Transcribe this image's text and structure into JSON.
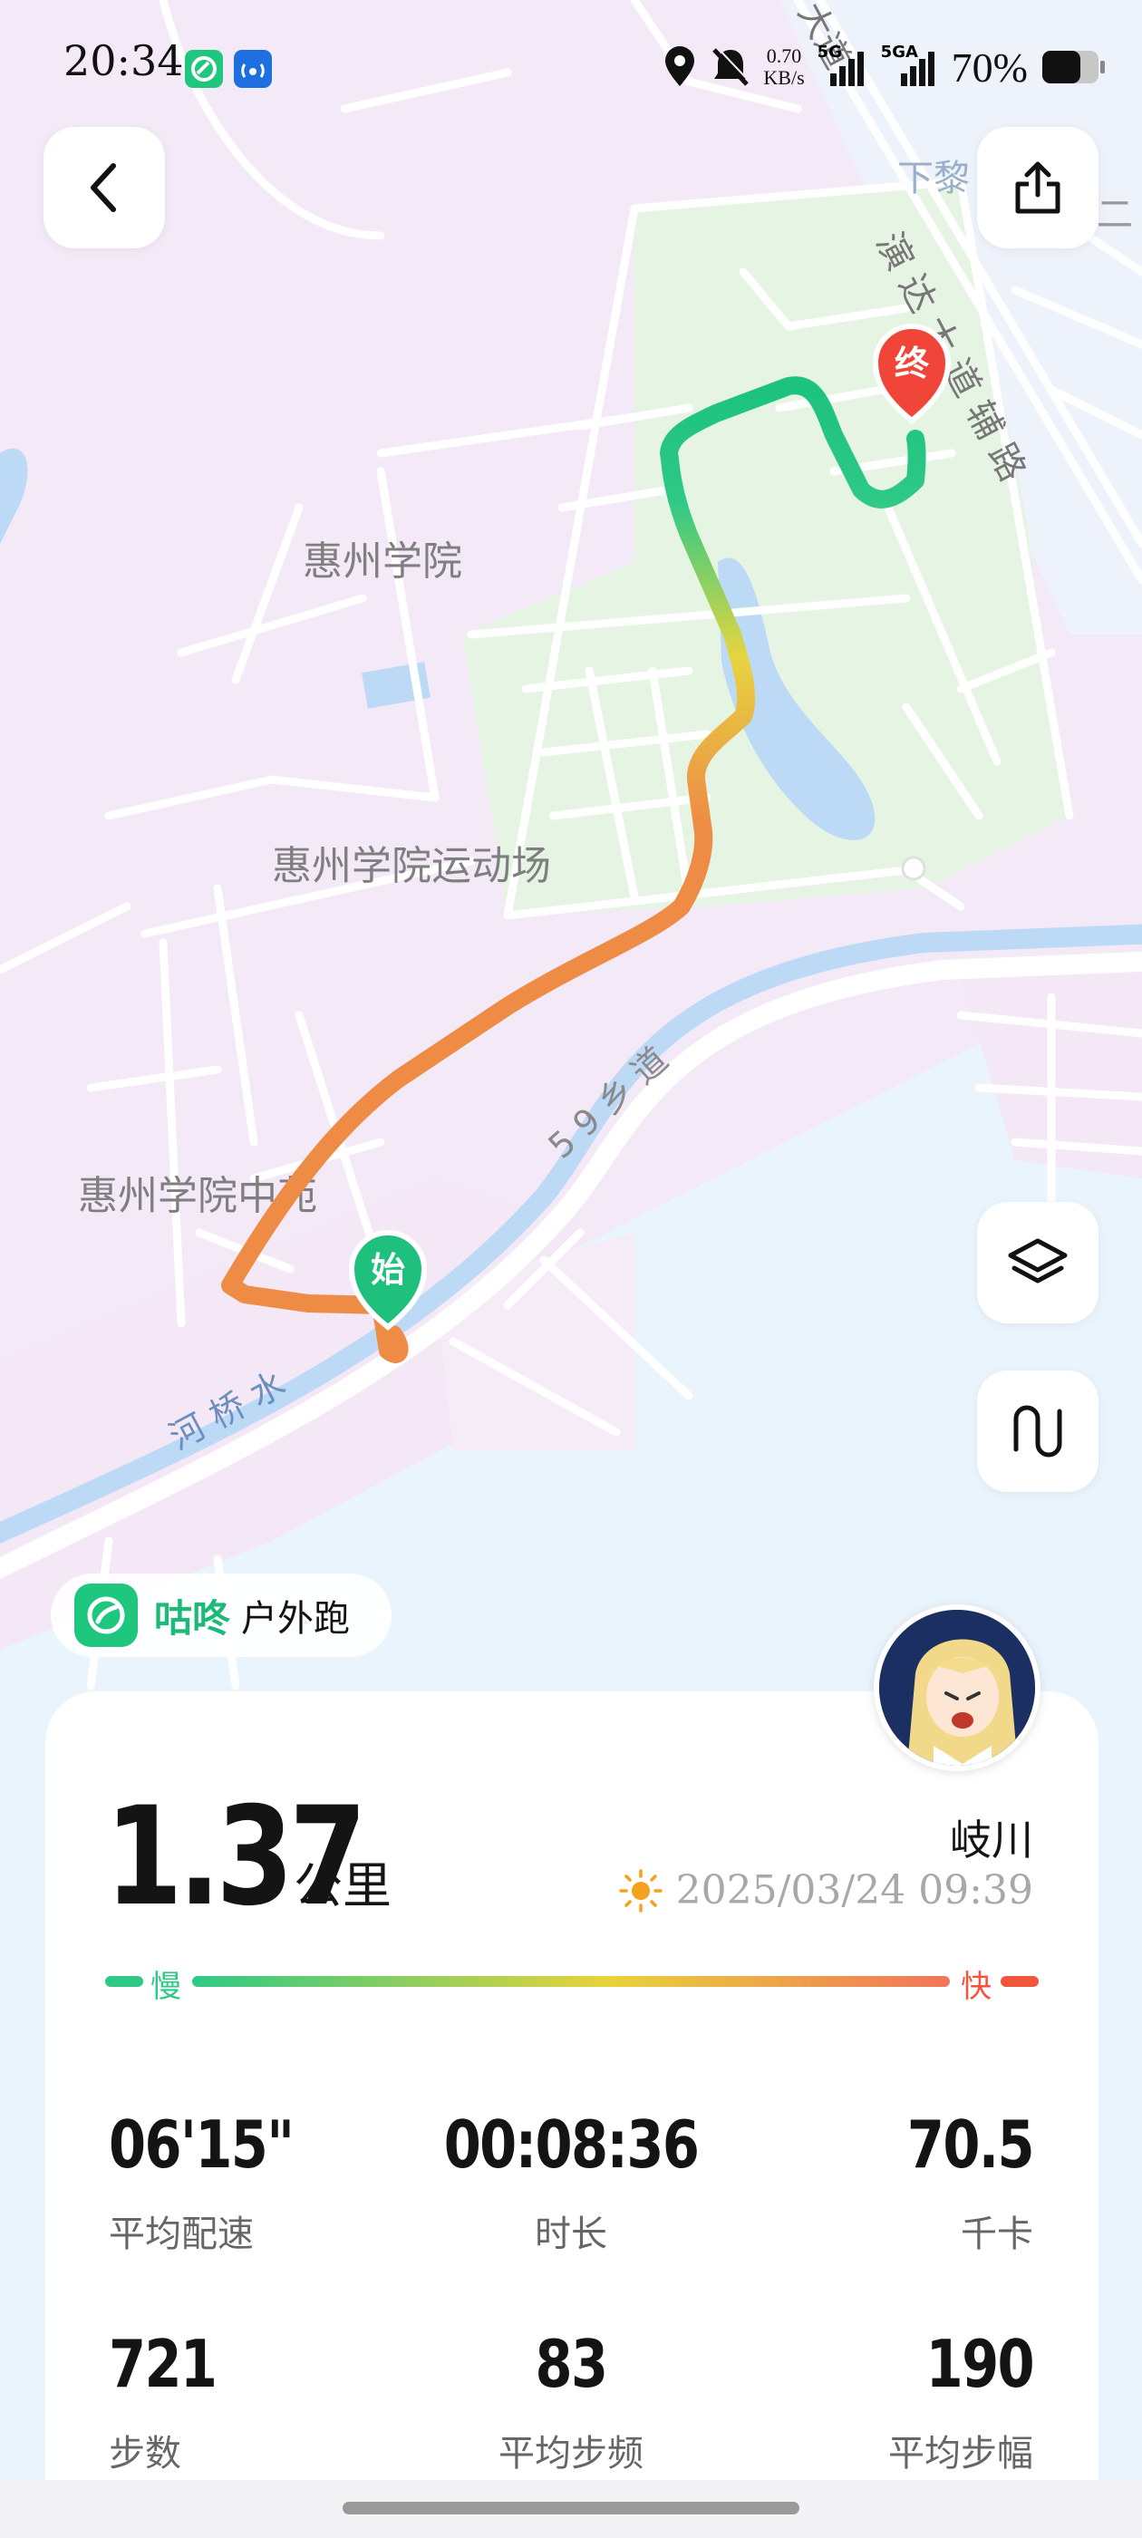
{
  "status_bar": {
    "time": "20:34",
    "net_speed_value": "0.70",
    "net_speed_unit": "KB/s",
    "sim1_label": "5G",
    "sim2_label": "5GA",
    "battery": "70%"
  },
  "map": {
    "labels": {
      "campus": "惠州学院",
      "stadium": "惠州学院运动场",
      "garden": "惠州学院中苑",
      "road_59": "5 9 乡 道",
      "river": "河 桥 水",
      "ave_side": "演 达 大 道 辅 路",
      "ave_top": "大道",
      "xiali": "下黎",
      "edge": "二"
    },
    "start_marker": "始",
    "end_marker": "终"
  },
  "brand": {
    "name": "咕咚",
    "activity": "户外跑"
  },
  "summary": {
    "distance": "1.37",
    "distance_unit": "公里",
    "user_name": "岐川",
    "datetime": "2025/03/24 09:39",
    "slow_label": "慢",
    "fast_label": "快"
  },
  "stats": [
    {
      "value": "06'15\"",
      "label": "平均配速"
    },
    {
      "value": "00:08:36",
      "label": "时长"
    },
    {
      "value": "70.5",
      "label": "千卡"
    },
    {
      "value": "721",
      "label": "步数"
    },
    {
      "value": "83",
      "label": "平均步频"
    },
    {
      "value": "190",
      "label": "平均步幅"
    }
  ],
  "colors": {
    "slow": "#2ec986",
    "mid": "#e8d33a",
    "fast": "#f2563a",
    "brand_green": "#1db978"
  }
}
